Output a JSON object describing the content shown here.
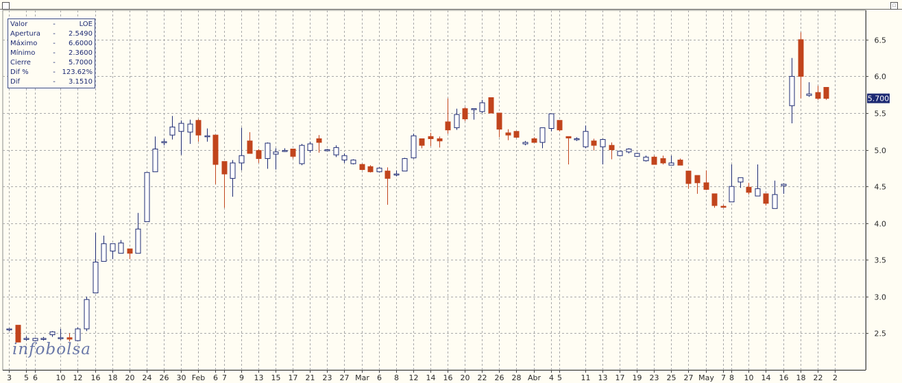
{
  "info_panel": {
    "rows": [
      {
        "label": "Valor",
        "value": "LOE"
      },
      {
        "label": "Apertura",
        "value": "2.5490"
      },
      {
        "label": "Máximo",
        "value": "6.6000"
      },
      {
        "label": "Mínimo",
        "value": "2.3600"
      },
      {
        "label": "Cierre",
        "value": "5.7000"
      },
      {
        "label": "Dif %",
        "value": "123.62%"
      },
      {
        "label": "Dif",
        "value": "3.1510"
      }
    ]
  },
  "logo": {
    "text": "infobolsa"
  },
  "colors": {
    "up_candle": "#ffffff",
    "down_candle": "#c1441c",
    "outline": "#1d2a73",
    "background": "#fffdf3",
    "grid": "#a8a8a8",
    "last_price_badge": "#1d2a73"
  },
  "chart_data": {
    "type": "candlestick",
    "ylim": [
      2.0,
      6.9
    ],
    "y_ticks": [
      "2.5",
      "3.0",
      "3.5",
      "4.0",
      "4.5",
      "5.0",
      "5.5",
      "6.0",
      "6.5"
    ],
    "grid": true,
    "last_price": "5.700",
    "x_labels": [
      "3",
      "5",
      "6",
      "10",
      "12",
      "16",
      "18",
      "20",
      "24",
      "26",
      "30",
      "Feb",
      "6",
      "7",
      "9",
      "13",
      "15",
      "17",
      "21",
      "23",
      "27",
      "Mar",
      "6",
      "8",
      "12",
      "14",
      "16",
      "20",
      "22",
      "26",
      "28",
      "Abr",
      "4",
      "5",
      "11",
      "13",
      "17",
      "19",
      "23",
      "25",
      "27",
      "May",
      "7",
      "8",
      "10",
      "14",
      "16",
      "18",
      "22",
      "2"
    ],
    "x_label_slots": [
      0,
      2,
      3,
      6,
      8,
      10,
      12,
      14,
      16,
      18,
      20,
      22,
      24,
      25,
      27,
      29,
      31,
      33,
      35,
      37,
      39,
      41,
      43,
      45,
      47,
      49,
      51,
      53,
      55,
      57,
      59,
      61,
      63,
      64,
      67,
      69,
      71,
      73,
      75,
      77,
      79,
      81,
      83,
      84,
      86,
      88,
      90,
      92,
      94,
      96
    ],
    "candles": [
      {
        "o": 2.55,
        "h": 2.57,
        "l": 2.53,
        "c": 2.56
      },
      {
        "o": 2.61,
        "h": 2.61,
        "l": 2.38,
        "c": 2.38
      },
      {
        "o": 2.43,
        "h": 2.46,
        "l": 2.4,
        "c": 2.43
      },
      {
        "o": 2.4,
        "h": 2.44,
        "l": 2.39,
        "c": 2.43
      },
      {
        "o": 2.42,
        "h": 2.45,
        "l": 2.4,
        "c": 2.43
      },
      {
        "o": 2.48,
        "h": 2.53,
        "l": 2.45,
        "c": 2.52
      },
      {
        "o": 2.44,
        "h": 2.56,
        "l": 2.41,
        "c": 2.44
      },
      {
        "o": 2.44,
        "h": 2.5,
        "l": 2.39,
        "c": 2.42
      },
      {
        "o": 2.4,
        "h": 2.58,
        "l": 2.39,
        "c": 2.56
      },
      {
        "o": 2.56,
        "h": 3.0,
        "l": 2.53,
        "c": 2.96
      },
      {
        "o": 3.05,
        "h": 3.87,
        "l": 3.05,
        "c": 3.47
      },
      {
        "o": 3.48,
        "h": 3.83,
        "l": 3.48,
        "c": 3.72
      },
      {
        "o": 3.62,
        "h": 3.72,
        "l": 3.51,
        "c": 3.72
      },
      {
        "o": 3.59,
        "h": 3.77,
        "l": 3.59,
        "c": 3.73
      },
      {
        "o": 3.65,
        "h": 3.65,
        "l": 3.51,
        "c": 3.59
      },
      {
        "o": 3.59,
        "h": 4.14,
        "l": 3.59,
        "c": 3.92
      },
      {
        "o": 4.02,
        "h": 4.69,
        "l": 4.02,
        "c": 4.69
      },
      {
        "o": 4.7,
        "h": 5.18,
        "l": 4.7,
        "c": 5.01
      },
      {
        "o": 5.1,
        "h": 5.15,
        "l": 5.06,
        "c": 5.11
      },
      {
        "o": 5.2,
        "h": 5.46,
        "l": 5.14,
        "c": 5.31
      },
      {
        "o": 5.25,
        "h": 5.4,
        "l": 4.93,
        "c": 5.36
      },
      {
        "o": 5.24,
        "h": 5.41,
        "l": 5.08,
        "c": 5.35
      },
      {
        "o": 5.4,
        "h": 5.42,
        "l": 5.11,
        "c": 5.2
      },
      {
        "o": 5.18,
        "h": 5.29,
        "l": 5.11,
        "c": 5.19
      },
      {
        "o": 5.2,
        "h": 5.2,
        "l": 4.53,
        "c": 4.8
      },
      {
        "o": 4.84,
        "h": 4.84,
        "l": 4.21,
        "c": 4.67
      },
      {
        "o": 4.61,
        "h": 4.86,
        "l": 4.36,
        "c": 4.82
      },
      {
        "o": 4.82,
        "h": 5.3,
        "l": 4.72,
        "c": 4.92
      },
      {
        "o": 5.12,
        "h": 5.24,
        "l": 4.95,
        "c": 4.95
      },
      {
        "o": 4.99,
        "h": 5.01,
        "l": 4.82,
        "c": 4.88
      },
      {
        "o": 4.88,
        "h": 5.1,
        "l": 4.74,
        "c": 5.09
      },
      {
        "o": 4.94,
        "h": 5.02,
        "l": 4.73,
        "c": 4.97
      },
      {
        "o": 4.98,
        "h": 5.02,
        "l": 4.97,
        "c": 4.99
      },
      {
        "o": 5.01,
        "h": 5.01,
        "l": 4.88,
        "c": 4.91
      },
      {
        "o": 4.81,
        "h": 5.08,
        "l": 4.79,
        "c": 5.06
      },
      {
        "o": 4.99,
        "h": 5.11,
        "l": 4.96,
        "c": 5.08
      },
      {
        "o": 5.15,
        "h": 5.2,
        "l": 4.96,
        "c": 5.1
      },
      {
        "o": 5.0,
        "h": 5.01,
        "l": 4.99,
        "c": 5.0
      },
      {
        "o": 4.93,
        "h": 5.06,
        "l": 4.9,
        "c": 5.03
      },
      {
        "o": 4.86,
        "h": 4.95,
        "l": 4.82,
        "c": 4.92
      },
      {
        "o": 4.81,
        "h": 4.87,
        "l": 4.8,
        "c": 4.86
      },
      {
        "o": 4.8,
        "h": 4.81,
        "l": 4.72,
        "c": 4.73
      },
      {
        "o": 4.77,
        "h": 4.79,
        "l": 4.69,
        "c": 4.7
      },
      {
        "o": 4.7,
        "h": 4.76,
        "l": 4.69,
        "c": 4.75
      },
      {
        "o": 4.71,
        "h": 4.76,
        "l": 4.25,
        "c": 4.61
      },
      {
        "o": 4.67,
        "h": 4.72,
        "l": 4.64,
        "c": 4.67
      },
      {
        "o": 4.71,
        "h": 4.89,
        "l": 4.71,
        "c": 4.88
      },
      {
        "o": 4.89,
        "h": 5.22,
        "l": 4.88,
        "c": 5.19
      },
      {
        "o": 5.15,
        "h": 5.15,
        "l": 5.02,
        "c": 5.06
      },
      {
        "o": 5.18,
        "h": 5.23,
        "l": 5.05,
        "c": 5.15
      },
      {
        "o": 5.15,
        "h": 5.18,
        "l": 5.03,
        "c": 5.12
      },
      {
        "o": 5.38,
        "h": 5.7,
        "l": 5.22,
        "c": 5.27
      },
      {
        "o": 5.3,
        "h": 5.56,
        "l": 5.27,
        "c": 5.48
      },
      {
        "o": 5.56,
        "h": 5.58,
        "l": 5.39,
        "c": 5.42
      },
      {
        "o": 5.55,
        "h": 5.56,
        "l": 5.41,
        "c": 5.56
      },
      {
        "o": 5.52,
        "h": 5.68,
        "l": 5.5,
        "c": 5.64
      },
      {
        "o": 5.71,
        "h": 5.71,
        "l": 5.5,
        "c": 5.5
      },
      {
        "o": 5.5,
        "h": 5.5,
        "l": 5.17,
        "c": 5.28
      },
      {
        "o": 5.23,
        "h": 5.28,
        "l": 5.13,
        "c": 5.2
      },
      {
        "o": 5.25,
        "h": 5.25,
        "l": 5.16,
        "c": 5.17
      },
      {
        "o": 5.08,
        "h": 5.12,
        "l": 5.06,
        "c": 5.1
      },
      {
        "o": 5.15,
        "h": 5.17,
        "l": 5.1,
        "c": 5.1
      },
      {
        "o": 5.1,
        "h": 5.3,
        "l": 5.02,
        "c": 5.3
      },
      {
        "o": 5.29,
        "h": 5.49,
        "l": 5.25,
        "c": 5.49
      },
      {
        "o": 5.4,
        "h": 5.4,
        "l": 5.25,
        "c": 5.27
      },
      {
        "o": 5.18,
        "h": 5.18,
        "l": 4.8,
        "c": 5.16
      },
      {
        "o": 5.15,
        "h": 5.17,
        "l": 5.12,
        "c": 5.15
      },
      {
        "o": 5.04,
        "h": 5.33,
        "l": 5.02,
        "c": 5.25
      },
      {
        "o": 5.12,
        "h": 5.15,
        "l": 4.99,
        "c": 5.06
      },
      {
        "o": 5.04,
        "h": 5.15,
        "l": 4.8,
        "c": 5.14
      },
      {
        "o": 5.06,
        "h": 5.1,
        "l": 4.87,
        "c": 5.0
      },
      {
        "o": 4.92,
        "h": 4.97,
        "l": 4.91,
        "c": 4.98
      },
      {
        "o": 4.97,
        "h": 5.02,
        "l": 4.95,
        "c": 5.01
      },
      {
        "o": 4.91,
        "h": 4.96,
        "l": 4.9,
        "c": 4.95
      },
      {
        "o": 4.85,
        "h": 4.92,
        "l": 4.84,
        "c": 4.9
      },
      {
        "o": 4.9,
        "h": 4.92,
        "l": 4.8,
        "c": 4.8
      },
      {
        "o": 4.88,
        "h": 4.92,
        "l": 4.8,
        "c": 4.82
      },
      {
        "o": 4.79,
        "h": 4.92,
        "l": 4.79,
        "c": 4.82
      },
      {
        "o": 4.86,
        "h": 4.88,
        "l": 4.8,
        "c": 4.79
      },
      {
        "o": 4.71,
        "h": 4.71,
        "l": 4.47,
        "c": 4.54
      },
      {
        "o": 4.65,
        "h": 4.65,
        "l": 4.4,
        "c": 4.55
      },
      {
        "o": 4.55,
        "h": 4.72,
        "l": 4.45,
        "c": 4.46
      },
      {
        "o": 4.4,
        "h": 4.4,
        "l": 4.21,
        "c": 4.24
      },
      {
        "o": 4.23,
        "h": 4.25,
        "l": 4.21,
        "c": 4.22
      },
      {
        "o": 4.29,
        "h": 4.8,
        "l": 4.29,
        "c": 4.5
      },
      {
        "o": 4.56,
        "h": 4.6,
        "l": 4.48,
        "c": 4.62
      },
      {
        "o": 4.49,
        "h": 4.55,
        "l": 4.39,
        "c": 4.42
      },
      {
        "o": 4.37,
        "h": 4.8,
        "l": 4.37,
        "c": 4.47
      },
      {
        "o": 4.4,
        "h": 4.4,
        "l": 4.24,
        "c": 4.27
      },
      {
        "o": 4.2,
        "h": 4.58,
        "l": 4.2,
        "c": 4.39
      },
      {
        "o": 4.51,
        "h": 4.54,
        "l": 4.4,
        "c": 4.53
      },
      {
        "o": 5.6,
        "h": 6.25,
        "l": 5.36,
        "c": 6.0
      },
      {
        "o": 6.5,
        "h": 6.6,
        "l": 5.7,
        "c": 6.0
      },
      {
        "o": 5.74,
        "h": 5.92,
        "l": 5.72,
        "c": 5.76
      },
      {
        "o": 5.78,
        "h": 5.87,
        "l": 5.68,
        "c": 5.7
      },
      {
        "o": 5.85,
        "h": 5.85,
        "l": 5.68,
        "c": 5.7
      }
    ]
  }
}
